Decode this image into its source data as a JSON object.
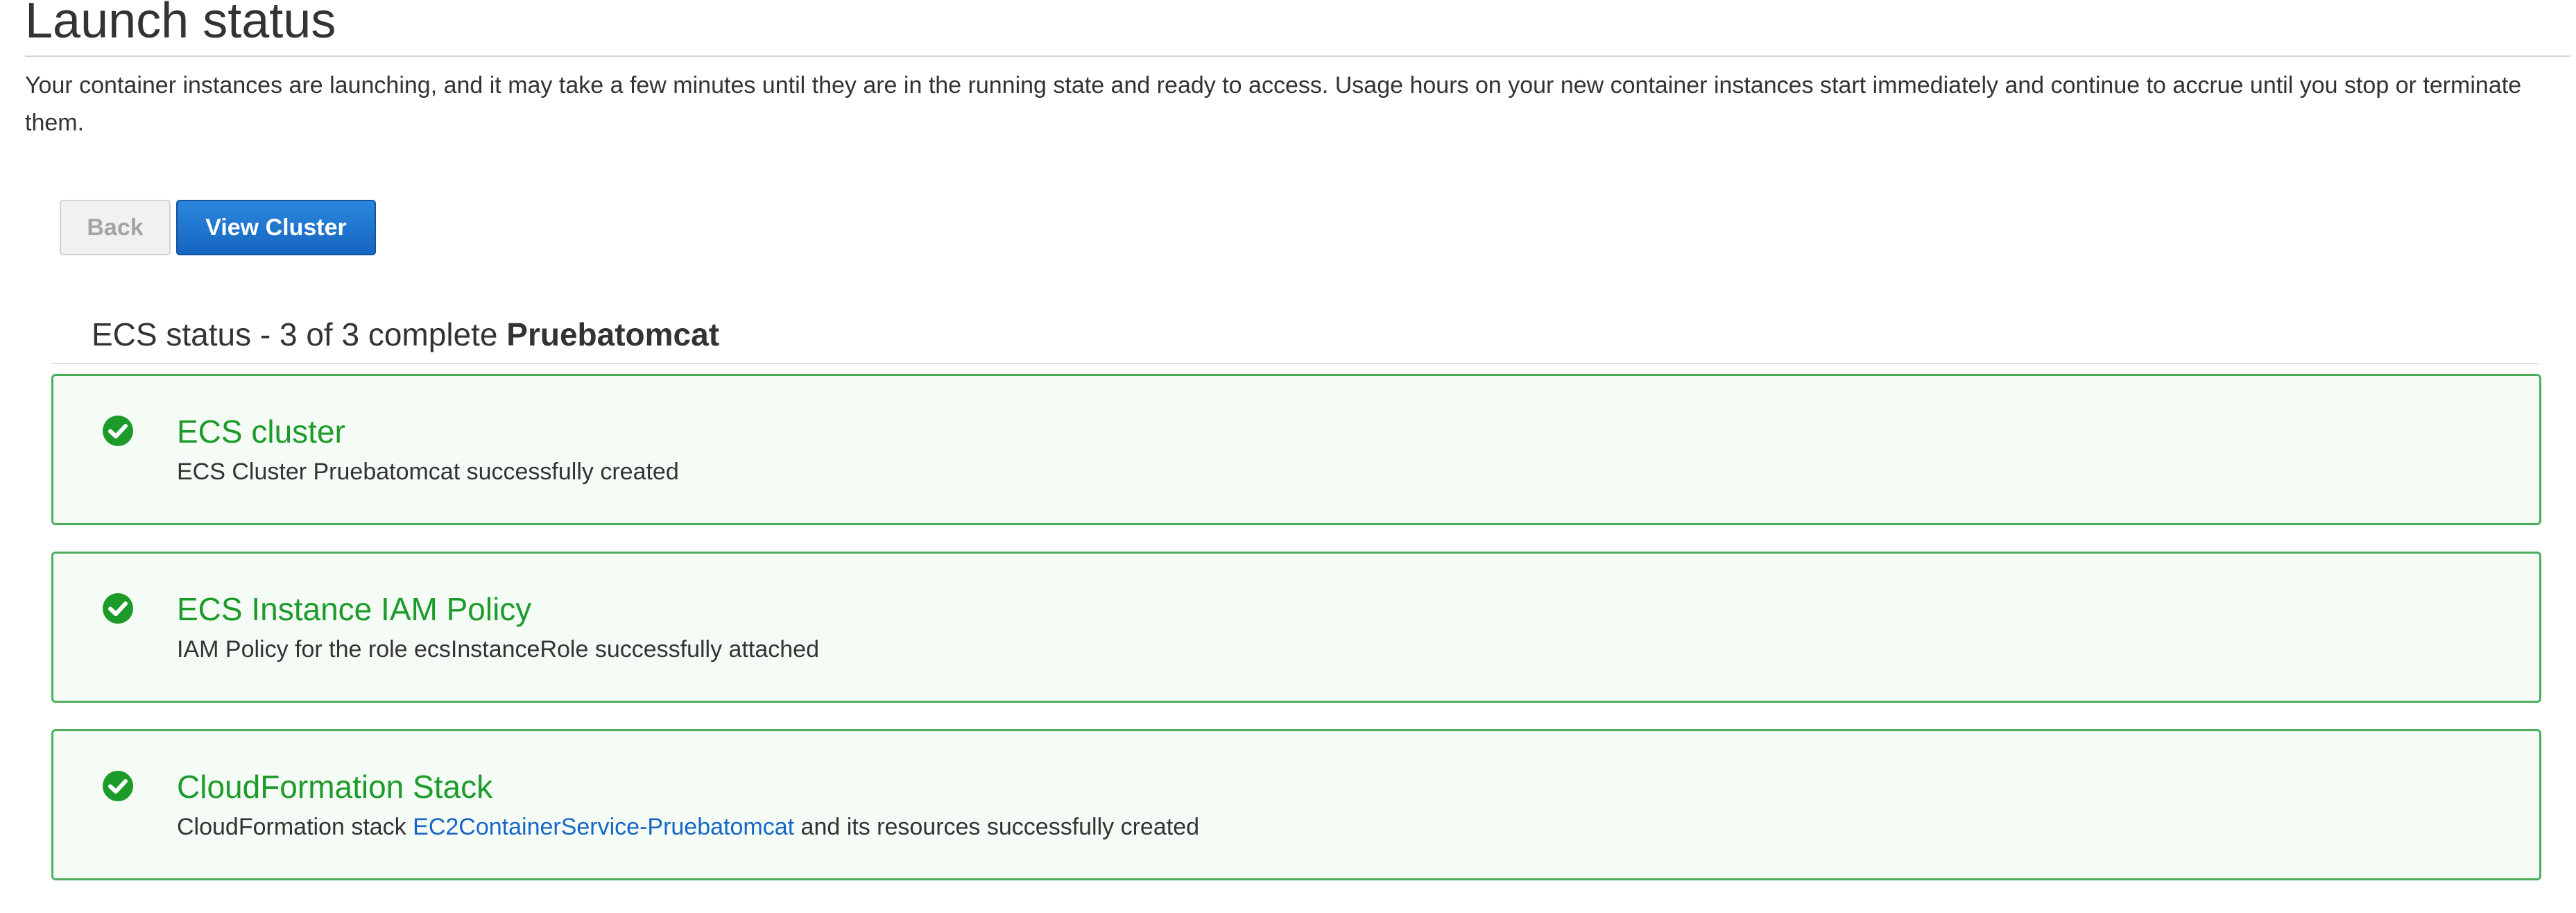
{
  "page": {
    "title": "Launch status",
    "intro": "Your container instances are launching, and it may take a few minutes until they are in the running state and ready to access. Usage hours on your new container instances start immediately and continue to accrue until you stop or terminate them."
  },
  "actions": {
    "back_label": "Back",
    "view_cluster_label": "View Cluster"
  },
  "ecs_status": {
    "heading_prefix": "ECS status - 3 of 3 complete",
    "cluster_name": "Pruebatomcat"
  },
  "steps": [
    {
      "title": "ECS cluster",
      "description": "ECS Cluster Pruebatomcat successfully created",
      "icon": "check-circle-icon"
    },
    {
      "title": "ECS Instance IAM Policy",
      "description": "IAM Policy for the role ecsInstanceRole successfully attached",
      "icon": "check-circle-icon"
    },
    {
      "title": "CloudFormation Stack",
      "description_prefix": "CloudFormation stack",
      "stack_link": "EC2ContainerService-Pruebatomcat",
      "description_suffix": "and its resources successfully created",
      "icon": "check-circle-icon"
    }
  ],
  "colors": {
    "success": "#1d9b2a",
    "primary": "#1665c1",
    "link": "#1667c6"
  }
}
